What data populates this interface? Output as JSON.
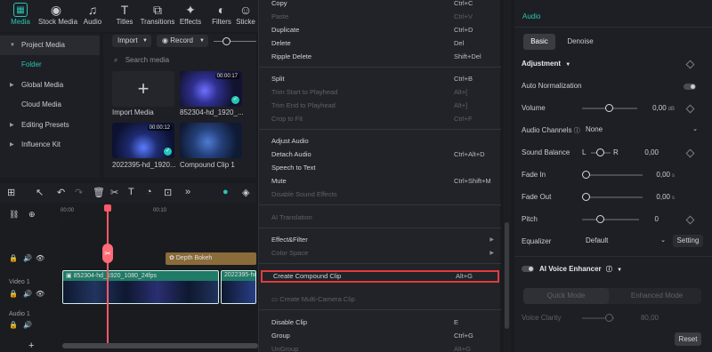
{
  "toolbar": {
    "items": [
      {
        "label": "Media",
        "icon": "media-icon"
      },
      {
        "label": "Stock Media",
        "icon": "stock-media-icon"
      },
      {
        "label": "Audio",
        "icon": "music-note-icon"
      },
      {
        "label": "Titles",
        "icon": "titles-icon"
      },
      {
        "label": "Transitions",
        "icon": "transitions-icon"
      },
      {
        "label": "Effects",
        "icon": "effects-icon"
      },
      {
        "label": "Filters",
        "icon": "filters-icon"
      },
      {
        "label": "Sticke",
        "icon": "stickers-icon"
      }
    ]
  },
  "sidebar": {
    "items": [
      {
        "label": "Project Media",
        "expanded": true
      },
      {
        "label": "Folder"
      },
      {
        "label": "Global Media"
      },
      {
        "label": "Cloud Media"
      },
      {
        "label": "Editing Presets"
      },
      {
        "label": "Influence Kit"
      }
    ]
  },
  "media": {
    "import_label": "Import",
    "record_label": "Record",
    "search_placeholder": "Search media",
    "tiles": [
      {
        "label": "Import Media"
      },
      {
        "label": "852304-hd_1920_...",
        "duration": "00:00:17"
      },
      {
        "label": "2022395-hd_1920...",
        "duration": "00:00:12"
      },
      {
        "label": "Compound Clip 1"
      }
    ]
  },
  "timeline": {
    "ruler": [
      "00:00",
      "00:10"
    ],
    "tracks": [
      {
        "label": "Video 1"
      },
      {
        "label": "Audio 1"
      }
    ],
    "clips": [
      {
        "label": "Depth Bokeh"
      },
      {
        "label": "852304-hd_1920_1080_24fps"
      },
      {
        "label": "2022395-hd"
      }
    ]
  },
  "context_menu": {
    "items": [
      {
        "label": "Copy",
        "shortcut": "Ctrl+C",
        "disabled": false
      },
      {
        "label": "Paste",
        "shortcut": "Ctrl+V",
        "disabled": true
      },
      {
        "label": "Duplicate",
        "shortcut": "Ctrl+D",
        "disabled": false
      },
      {
        "label": "Delete",
        "shortcut": "Del",
        "disabled": false
      },
      {
        "label": "Ripple Delete",
        "shortcut": "Shift+Del",
        "disabled": false
      },
      {
        "label": "Split",
        "shortcut": "Ctrl+B",
        "disabled": false
      },
      {
        "label": "Trim Start to Playhead",
        "shortcut": "Alt+[",
        "disabled": true
      },
      {
        "label": "Trim End to Playhead",
        "shortcut": "Alt+]",
        "disabled": true
      },
      {
        "label": "Crop to Fit",
        "shortcut": "Ctrl+F",
        "disabled": true
      },
      {
        "label": "Adjust Audio",
        "shortcut": "",
        "disabled": false
      },
      {
        "label": "Detach Audio",
        "shortcut": "Ctrl+Alt+D",
        "disabled": false
      },
      {
        "label": "Speech to Text",
        "shortcut": "",
        "disabled": false
      },
      {
        "label": "Mute",
        "shortcut": "Ctrl+Shift+M",
        "disabled": false
      },
      {
        "label": "Disable Sound Effects",
        "shortcut": "",
        "disabled": true
      },
      {
        "label": "AI Translation",
        "shortcut": "",
        "disabled": true
      },
      {
        "label": "Effect&Filter",
        "shortcut": "",
        "disabled": false
      },
      {
        "label": "Color Space",
        "shortcut": "",
        "disabled": true
      },
      {
        "label": "Create Compound Clip",
        "shortcut": "Alt+G",
        "disabled": false
      },
      {
        "label": "Create Multi-Camera Clip",
        "shortcut": "",
        "disabled": true
      },
      {
        "label": "Disable Clip",
        "shortcut": "E",
        "disabled": false
      },
      {
        "label": "Group",
        "shortcut": "Ctrl+G",
        "disabled": false
      },
      {
        "label": "UnGroup",
        "shortcut": "Alt+G",
        "disabled": true
      }
    ]
  },
  "audio_panel": {
    "title": "Audio",
    "tabs": [
      "Basic",
      "Denoise"
    ],
    "adjustment_label": "Adjustment",
    "auto_normalization_label": "Auto Normalization",
    "volume": {
      "label": "Volume",
      "value": "0,00",
      "unit": "dB"
    },
    "audio_channels": {
      "label": "Audio Channels",
      "value": "None"
    },
    "sound_balance": {
      "label": "Sound Balance",
      "left": "L",
      "right": "R",
      "value": "0,00"
    },
    "fade_in": {
      "label": "Fade In",
      "value": "0,00",
      "unit": "s"
    },
    "fade_out": {
      "label": "Fade Out",
      "value": "0,00",
      "unit": "s"
    },
    "pitch": {
      "label": "Pitch",
      "value": "0"
    },
    "equalizer": {
      "label": "Equalizer",
      "value": "Default",
      "setting_label": "Setting"
    },
    "ai_voice_enhancer_label": "AI Voice Enhancer",
    "modes": [
      "Quick Mode",
      "Enhanced Mode"
    ],
    "voice_clarity": {
      "label": "Voice Clarity",
      "value": "80,00"
    },
    "reset_label": "Reset"
  },
  "colors": {
    "accent": "#25c7b4",
    "playhead": "#ff5a67",
    "highlight_box": "#e03c3c",
    "video_clip": "#1f7a66",
    "effect_clip": "#8a6b3a"
  }
}
